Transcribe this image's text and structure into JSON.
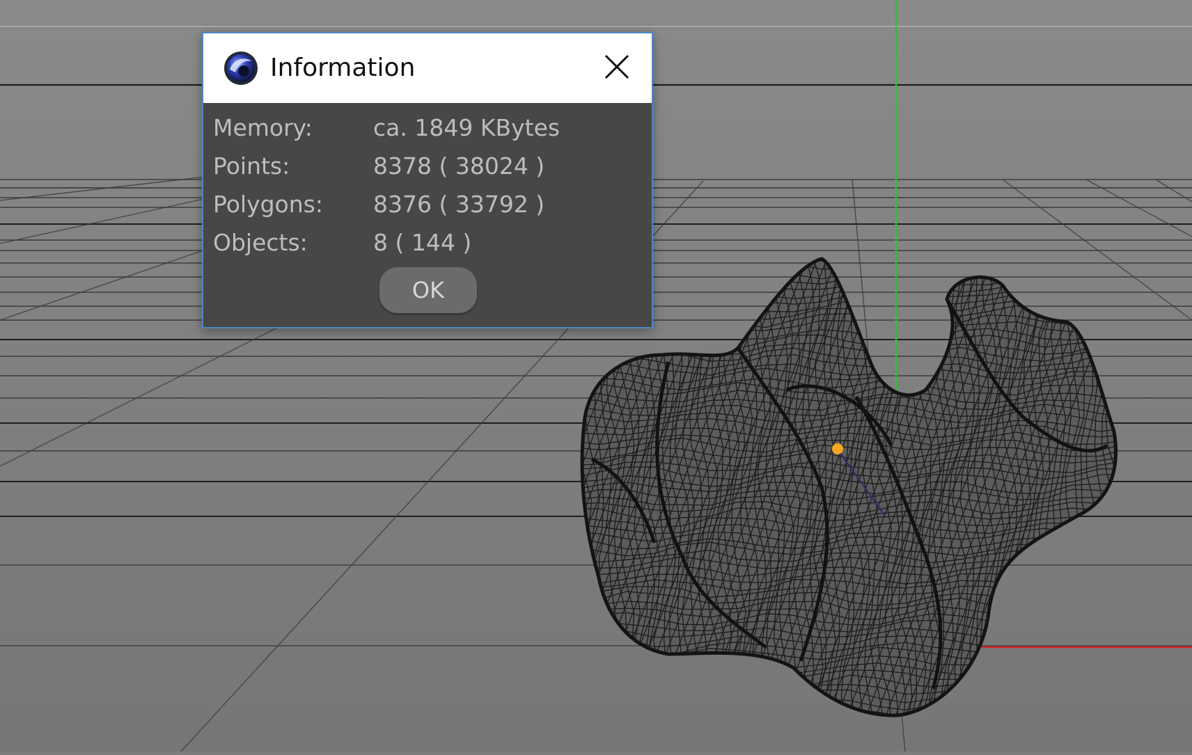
{
  "dialog": {
    "title": "Information",
    "app_logo": "cinema4d-logo-icon",
    "close_icon": "close-icon",
    "rows": [
      {
        "label": "Memory:",
        "value": "ca. 1849 KBytes"
      },
      {
        "label": "Points:",
        "value": "8378 ( 38024 )"
      },
      {
        "label": "Polygons:",
        "value": "8376 ( 33792 )"
      },
      {
        "label": "Objects:",
        "value": "8 ( 144 )"
      }
    ],
    "ok_label": "OK"
  },
  "viewport": {
    "background_color": "#7d7d7d",
    "grid_color": "#1e1e1e",
    "axis_y_color": "#2fbf3a",
    "axis_x_color": "#d02424",
    "object_pivot_color": "#f5a623"
  }
}
